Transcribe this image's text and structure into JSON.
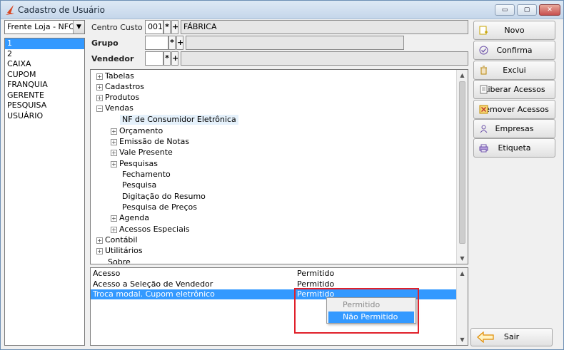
{
  "window": {
    "title": "Cadastro de Usuário",
    "controls": {
      "minimize": "▭",
      "maximize": "▢",
      "close": "✕"
    }
  },
  "user_filter": {
    "selected": "Frente Loja - NFC-e"
  },
  "user_list": {
    "items": [
      "1",
      "2",
      "CAIXA",
      "CUPOM",
      "FRANQUIA",
      "GERENTE",
      "PESQUISA",
      "USUÁRIO"
    ]
  },
  "form": {
    "centro_custo": {
      "label": "Centro Custo",
      "code": "001",
      "name": "FÁBRICA"
    },
    "grupo": {
      "label": "Grupo",
      "code": "",
      "name": ""
    },
    "vendedor": {
      "label": "Vendedor",
      "code": "",
      "name": ""
    },
    "lookup_symbol": "*",
    "add_symbol": "+"
  },
  "tree": {
    "expander_collapsed": "+",
    "expander_expanded": "−",
    "nodes": [
      {
        "label": "Tabelas"
      },
      {
        "label": "Cadastros"
      },
      {
        "label": "Produtos"
      },
      {
        "label": "Vendas"
      },
      {
        "label": "NF de Consumidor Eletrônica"
      },
      {
        "label": "Orçamento"
      },
      {
        "label": "Emissão de Notas"
      },
      {
        "label": "Vale Presente"
      },
      {
        "label": "Pesquisas"
      },
      {
        "label": "Fechamento"
      },
      {
        "label": "Pesquisa"
      },
      {
        "label": "Digitação do Resumo"
      },
      {
        "label": "Pesquisa de Preços"
      },
      {
        "label": "Agenda"
      },
      {
        "label": "Acessos Especiais"
      },
      {
        "label": "Contábil"
      },
      {
        "label": "Utilitários"
      },
      {
        "label": "Sobre"
      }
    ]
  },
  "permissions": {
    "rows": [
      {
        "name": "Acesso",
        "value": "Permitido"
      },
      {
        "name": "Acesso a Seleção de Vendedor",
        "value": "Permitido"
      },
      {
        "name": "Troca modal. Cupom eletrônico",
        "value": "Permitido"
      }
    ],
    "dropdown": {
      "options": [
        "Permitido",
        "Não Permitido"
      ],
      "highlighted": "Não Permitido"
    }
  },
  "actions": {
    "novo": "Novo",
    "confirma": "Confirma",
    "exclui": "Exclui",
    "liberar": "Liberar Acessos",
    "remover": "Remover Acessos",
    "empresas": "Empresas",
    "etiqueta": "Etiqueta",
    "sair": "Sair"
  },
  "colors": {
    "selection": "#3399ff",
    "highlight_box": "#e0202a",
    "title_bar": "#c5d6ea"
  }
}
